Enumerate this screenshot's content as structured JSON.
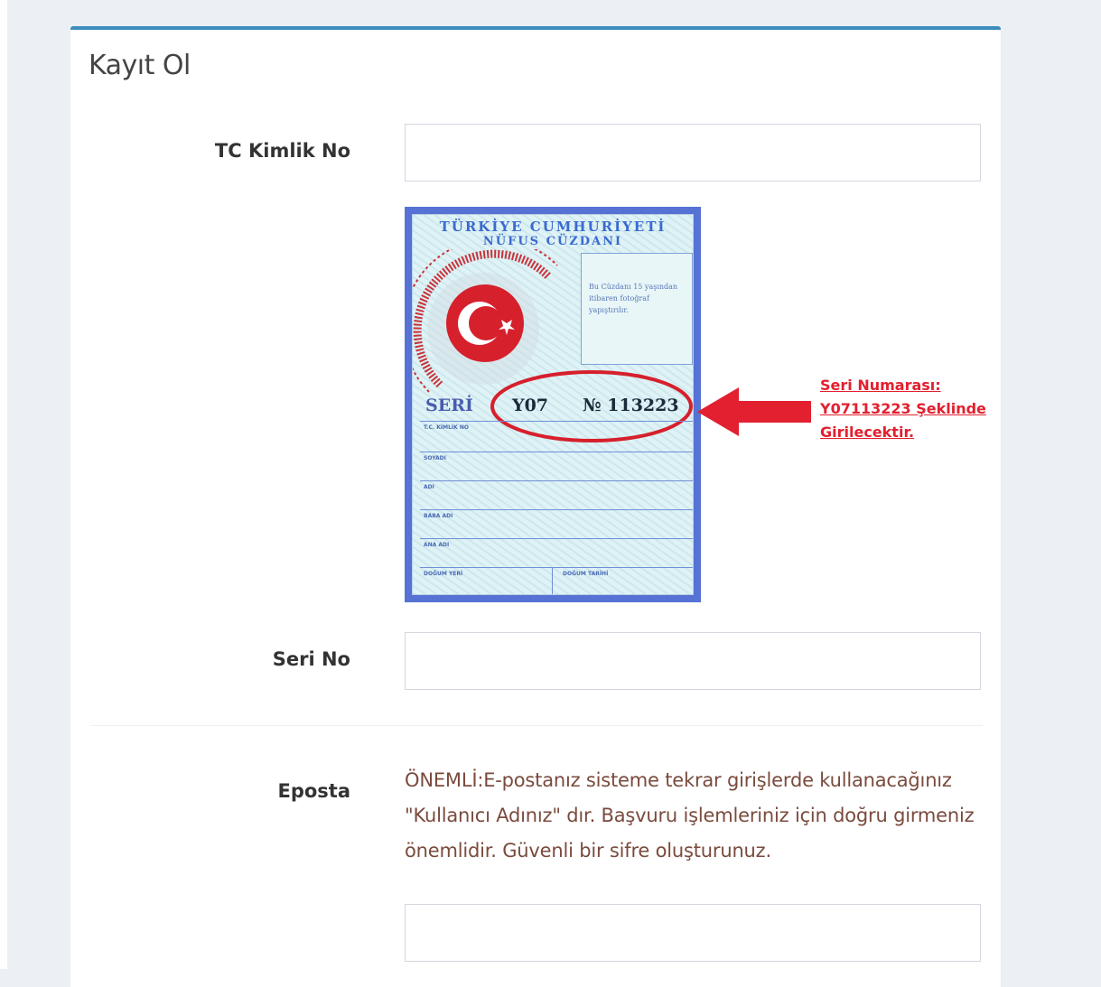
{
  "form": {
    "title": "Kayıt Ol",
    "fields": {
      "tc_label": "TC Kimlik No",
      "tc_value": "",
      "seri_label": "Seri No",
      "seri_value": "",
      "eposta_label": "Eposta",
      "eposta_value": ""
    },
    "eposta_note": "ÖNEMLİ:E-postanız sisteme tekrar girişlerde kullanacağınız \"Kullanıcı Adınız\" dır. Başvuru işlemleriniz için doğru girmeniz önemlidir. Güvenli bir sifre oluşturunuz."
  },
  "id_card": {
    "line1": "TÜRKİYE CUMHURİYETİ",
    "line2": "NÜFUS CÜZDANI",
    "photo_note": "Bu Cüzdanı 15 yaşından itibaren fotoğraf yapıştırılır.",
    "serial_prefix": "SERİ",
    "serial_code": "Y07",
    "serial_number_label": "№ 113223",
    "field_labels": [
      "T.C. KİMLİK NO",
      "SOYADI",
      "ADI",
      "BABA ADI",
      "ANA ADI",
      "DOĞUM YERİ",
      "DOĞUM TARİHİ"
    ],
    "seal_text": "TÜRKİYE CUMHURİYETİ"
  },
  "annotation": {
    "line1": "Seri Numarası:",
    "line2": "Y07113223 Şeklinde",
    "line3": "Girilecektir."
  },
  "colors": {
    "accent": "#3c8dbc",
    "annotation": "#e2202f",
    "note_text": "#7a4b3d",
    "background": "#ecf0f5"
  }
}
